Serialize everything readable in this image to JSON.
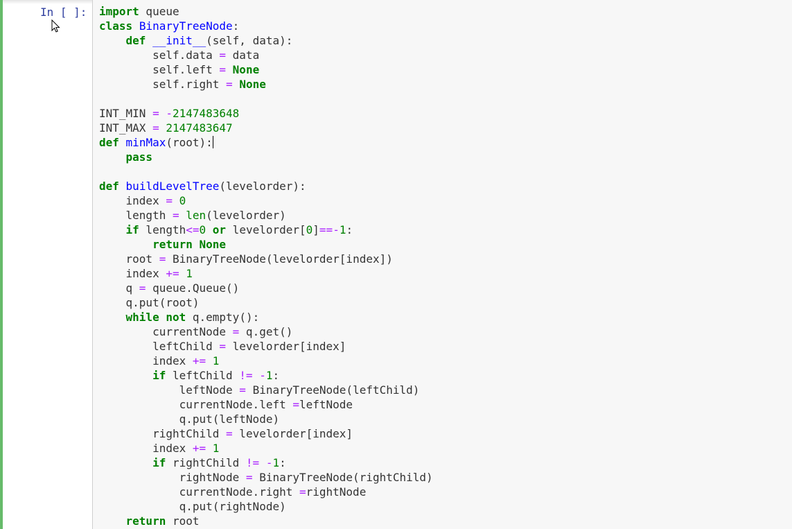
{
  "cell": {
    "prompt": "In [ ]:",
    "code_lines": [
      [
        {
          "t": "import",
          "c": "kw"
        },
        {
          "t": " queue"
        }
      ],
      [
        {
          "t": "class",
          "c": "kw"
        },
        {
          "t": " "
        },
        {
          "t": "BinaryTreeNode",
          "c": "fn"
        },
        {
          "t": ":"
        }
      ],
      [
        {
          "t": "    "
        },
        {
          "t": "def",
          "c": "kw"
        },
        {
          "t": " "
        },
        {
          "t": "__init__",
          "c": "fn"
        },
        {
          "t": "(self, data):"
        }
      ],
      [
        {
          "t": "        self.data "
        },
        {
          "t": "=",
          "c": "op"
        },
        {
          "t": " data"
        }
      ],
      [
        {
          "t": "        self.left "
        },
        {
          "t": "=",
          "c": "op"
        },
        {
          "t": " "
        },
        {
          "t": "None",
          "c": "kw"
        }
      ],
      [
        {
          "t": "        self.right "
        },
        {
          "t": "=",
          "c": "op"
        },
        {
          "t": " "
        },
        {
          "t": "None",
          "c": "kw"
        }
      ],
      [],
      [
        {
          "t": "INT_MIN "
        },
        {
          "t": "=",
          "c": "op"
        },
        {
          "t": " "
        },
        {
          "t": "-",
          "c": "op"
        },
        {
          "t": "2147483648",
          "c": "num"
        }
      ],
      [
        {
          "t": "INT_MAX "
        },
        {
          "t": "=",
          "c": "op"
        },
        {
          "t": " "
        },
        {
          "t": "2147483647",
          "c": "num"
        }
      ],
      [
        {
          "t": "def",
          "c": "kw"
        },
        {
          "t": " "
        },
        {
          "t": "minMax",
          "c": "fn"
        },
        {
          "t": "(root):"
        },
        {
          "caret": true
        }
      ],
      [
        {
          "t": "    "
        },
        {
          "t": "pass",
          "c": "kw"
        }
      ],
      [],
      [
        {
          "t": "def",
          "c": "kw"
        },
        {
          "t": " "
        },
        {
          "t": "buildLevelTree",
          "c": "fn"
        },
        {
          "t": "(levelorder):"
        }
      ],
      [
        {
          "t": "    index "
        },
        {
          "t": "=",
          "c": "op"
        },
        {
          "t": " "
        },
        {
          "t": "0",
          "c": "num"
        }
      ],
      [
        {
          "t": "    length "
        },
        {
          "t": "=",
          "c": "op"
        },
        {
          "t": " "
        },
        {
          "t": "len",
          "c": "bi"
        },
        {
          "t": "(levelorder)"
        }
      ],
      [
        {
          "t": "    "
        },
        {
          "t": "if",
          "c": "kw"
        },
        {
          "t": " length"
        },
        {
          "t": "<=",
          "c": "op"
        },
        {
          "t": "0",
          "c": "num"
        },
        {
          "t": " "
        },
        {
          "t": "or",
          "c": "kw"
        },
        {
          "t": " levelorder["
        },
        {
          "t": "0",
          "c": "num"
        },
        {
          "t": "]"
        },
        {
          "t": "==-",
          "c": "op"
        },
        {
          "t": "1",
          "c": "num"
        },
        {
          "t": ":"
        }
      ],
      [
        {
          "t": "        "
        },
        {
          "t": "return",
          "c": "kw"
        },
        {
          "t": " "
        },
        {
          "t": "None",
          "c": "kw"
        }
      ],
      [
        {
          "t": "    root "
        },
        {
          "t": "=",
          "c": "op"
        },
        {
          "t": " BinaryTreeNode(levelorder[index])"
        }
      ],
      [
        {
          "t": "    index "
        },
        {
          "t": "+=",
          "c": "op"
        },
        {
          "t": " "
        },
        {
          "t": "1",
          "c": "num"
        }
      ],
      [
        {
          "t": "    q "
        },
        {
          "t": "=",
          "c": "op"
        },
        {
          "t": " queue.Queue()"
        }
      ],
      [
        {
          "t": "    q.put(root)"
        }
      ],
      [
        {
          "t": "    "
        },
        {
          "t": "while",
          "c": "kw"
        },
        {
          "t": " "
        },
        {
          "t": "not",
          "c": "kw"
        },
        {
          "t": " q.empty():"
        }
      ],
      [
        {
          "t": "        currentNode "
        },
        {
          "t": "=",
          "c": "op"
        },
        {
          "t": " q.get()"
        }
      ],
      [
        {
          "t": "        leftChild "
        },
        {
          "t": "=",
          "c": "op"
        },
        {
          "t": " levelorder[index]"
        }
      ],
      [
        {
          "t": "        index "
        },
        {
          "t": "+=",
          "c": "op"
        },
        {
          "t": " "
        },
        {
          "t": "1",
          "c": "num"
        }
      ],
      [
        {
          "t": "        "
        },
        {
          "t": "if",
          "c": "kw"
        },
        {
          "t": " leftChild "
        },
        {
          "t": "!=",
          "c": "op"
        },
        {
          "t": " "
        },
        {
          "t": "-",
          "c": "op"
        },
        {
          "t": "1",
          "c": "num"
        },
        {
          "t": ":"
        }
      ],
      [
        {
          "t": "            leftNode "
        },
        {
          "t": "=",
          "c": "op"
        },
        {
          "t": " BinaryTreeNode(leftChild)"
        }
      ],
      [
        {
          "t": "            currentNode.left "
        },
        {
          "t": "=",
          "c": "op"
        },
        {
          "t": "leftNode"
        }
      ],
      [
        {
          "t": "            q.put(leftNode)"
        }
      ],
      [
        {
          "t": "        rightChild "
        },
        {
          "t": "=",
          "c": "op"
        },
        {
          "t": " levelorder[index]"
        }
      ],
      [
        {
          "t": "        index "
        },
        {
          "t": "+=",
          "c": "op"
        },
        {
          "t": " "
        },
        {
          "t": "1",
          "c": "num"
        }
      ],
      [
        {
          "t": "        "
        },
        {
          "t": "if",
          "c": "kw"
        },
        {
          "t": " rightChild "
        },
        {
          "t": "!=",
          "c": "op"
        },
        {
          "t": " "
        },
        {
          "t": "-",
          "c": "op"
        },
        {
          "t": "1",
          "c": "num"
        },
        {
          "t": ":"
        }
      ],
      [
        {
          "t": "            rightNode "
        },
        {
          "t": "=",
          "c": "op"
        },
        {
          "t": " BinaryTreeNode(rightChild)"
        }
      ],
      [
        {
          "t": "            currentNode.right "
        },
        {
          "t": "=",
          "c": "op"
        },
        {
          "t": "rightNode"
        }
      ],
      [
        {
          "t": "            q.put(rightNode)"
        }
      ],
      [
        {
          "t": "    "
        },
        {
          "t": "return",
          "c": "kw"
        },
        {
          "t": " root"
        }
      ]
    ]
  },
  "icons": {
    "mouse_cursor": "arrow-cursor-icon"
  },
  "colors": {
    "cell_selected_bar": "#66bb6a",
    "prompt": "#303f9f",
    "keyword": "#008000",
    "operator": "#aa22ff",
    "function_name": "#0000ff",
    "editor_background": "#f7f7f7"
  }
}
